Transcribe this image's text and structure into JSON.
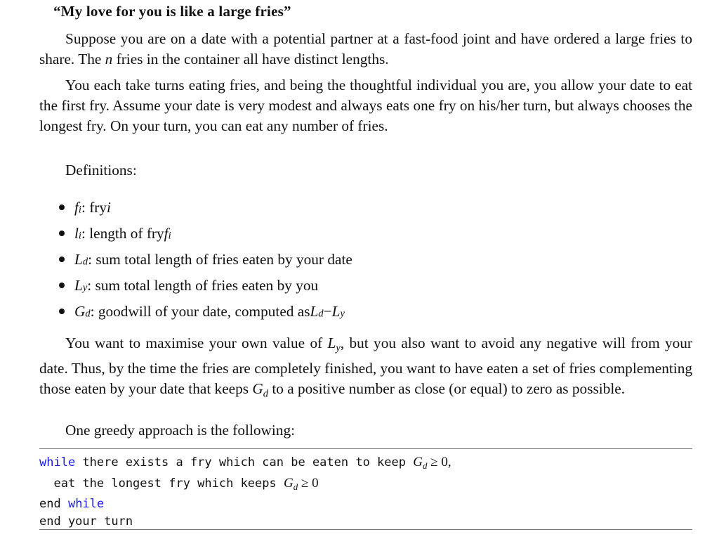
{
  "title": "“My love for you is like a large fries”",
  "paragraphs": {
    "p1": "Suppose you are on a date with a potential partner at a fast-food joint and have ordered a large fries to share. The n fries in the container all have distinct lengths.",
    "p1_parts": [
      "Suppose you are on a date with a potential partner at a fast-food joint and have ordered a large fries to share. The ",
      "n",
      " fries in the container all have distinct lengths."
    ],
    "p2": "You each take turns eating fries, and being the thoughtful individual you are, you allow your date to eat the first fry. Assume your date is very modest and always eats one fry on his/her turn, but always chooses the longest fry. On your turn, you can eat any number of fries.",
    "p3_parts": [
      "You want to maximise your own value of ",
      "L",
      "y",
      ", but you also want to avoid any negative will from your date. Thus, by the time the fries are completely finished, you want to have eaten a set of fries complementing those eaten by your date that keeps ",
      "G",
      "d",
      " to a positive number as close (or equal) to zero as possible."
    ],
    "p4": "One greedy approach is the following:"
  },
  "definitions": {
    "label": "Definitions:",
    "items": [
      {
        "sym": "f",
        "sub": "i",
        "text": ": fry ",
        "tail_sym": "i",
        "tail_sub": ""
      },
      {
        "sym": "l",
        "sub": "i",
        "text": ": length of fry ",
        "tail_sym": "f",
        "tail_sub": "i"
      },
      {
        "sym": "L",
        "sub": "d",
        "text": ": sum total length of fries eaten by your date",
        "tail_sym": "",
        "tail_sub": ""
      },
      {
        "sym": "L",
        "sub": "y",
        "text": ": sum total length of fries eaten by you",
        "tail_sym": "",
        "tail_sub": ""
      },
      {
        "sym": "G",
        "sub": "d",
        "text": ": goodwill of your date, computed as ",
        "tail_sym": "L",
        "tail_sub": "d",
        "tail2": " − ",
        "tail2_sym": "L",
        "tail2_sub": "y"
      }
    ]
  },
  "code": {
    "lines": [
      {
        "kw": "while",
        "text": " there exists a fry which can be eaten to keep ",
        "math": "G",
        "sub": "d",
        "after": " ≥ 0,"
      },
      {
        "kw": "",
        "text": "  eat the longest fry which keeps ",
        "math": "G",
        "sub": "d",
        "after": " ≥ 0"
      },
      {
        "kw": "",
        "text": "end ",
        "kw2": "while"
      },
      {
        "kw": "",
        "text": "end your turn"
      }
    ],
    "keyword_color": "#1a1aee"
  }
}
